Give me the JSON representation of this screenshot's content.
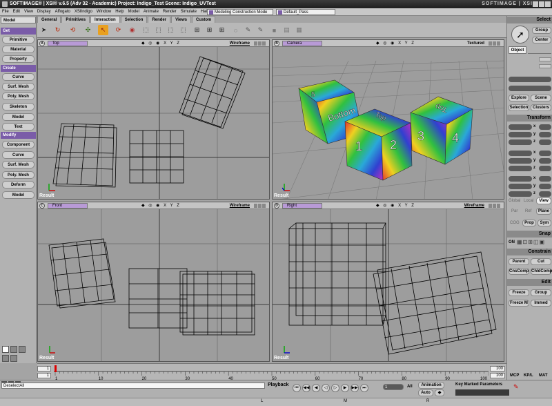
{
  "window": {
    "title": "SOFTIMAGE® | XSI® v.6.5 (Adv 32 - Academic) Project: Indigo_Test    Scene: Indigo_UVTest",
    "brand": "SOFTIMAGE | XSI"
  },
  "menu": [
    "File",
    "Edit",
    "View",
    "Display",
    "Affogato",
    "XSIIndigo",
    "Window",
    "Help",
    "Model",
    "Animate",
    "Render",
    "Simulate",
    "Hair"
  ],
  "mode_dropdown": "Modeling Construction Mode",
  "pass_dropdown": "Default_Pass",
  "toolbar_tabs": [
    "General",
    "Primitives",
    "Interaction",
    "Selection",
    "Render",
    "Views",
    "Custom"
  ],
  "toolbar_icons": [
    "pointer-icon",
    "rotate-icon",
    "rotate-icon",
    "scale-icon",
    "select-icon",
    "refresh-icon",
    "render-icon",
    "rectangle-select-icon",
    "rectangle-select-icon",
    "rectangle-select-icon",
    "rectangle-select-icon",
    "raycast-select-icon",
    "raycast-select-icon",
    "raycast-select-icon",
    "lasso-icon",
    "brush-icon",
    "brush-icon",
    "box-icon",
    "box-icon",
    "box-icon"
  ],
  "left_panel": {
    "model": "Model",
    "sections": [
      {
        "header": "Get",
        "buttons": [
          "Primitive",
          "Material",
          "Property"
        ]
      },
      {
        "header": "Create",
        "buttons": [
          "Curve",
          "Surf. Mesh",
          "Poly. Mesh",
          "Skeleton",
          "Model",
          "Text"
        ]
      },
      {
        "header": "Modify",
        "buttons": [
          "Component",
          "Curve",
          "Surf. Mesh",
          "Poly. Mesh",
          "Deform",
          "Model"
        ]
      }
    ]
  },
  "viewports": [
    {
      "letter": "A",
      "name": "Top",
      "icons": "◆ ◎ ◉ X Y Z",
      "mode": "Wireframe",
      "result": "Result"
    },
    {
      "letter": "B",
      "name": "Camera",
      "icons": "◆ ◎ ◉ X Y Z",
      "mode": "Textured",
      "result": "Result"
    },
    {
      "letter": "C",
      "name": "Front",
      "icons": "◆ ◎ ◉ X Y Z",
      "mode": "Wireframe",
      "result": "Result"
    },
    {
      "letter": "D",
      "name": "Right",
      "icons": "◆ ◎ ◉ X Y Z",
      "mode": "Wireframe",
      "result": "Result"
    }
  ],
  "camera_view": {
    "cube_labels": [
      "Top",
      "Bottom",
      "1",
      "2",
      "3",
      "4",
      "Top",
      "5"
    ]
  },
  "right_panel": {
    "select_header": "Select",
    "select_buttons": [
      "Group",
      "Center",
      "Object",
      "Explore",
      "Scene",
      "Selection",
      "Clusters"
    ],
    "transform_header": "Transform",
    "axes": [
      "x",
      "y",
      "z"
    ],
    "transform_modes": [
      "Global",
      "Local",
      "View",
      "Par",
      "Ref",
      "Plane",
      "COG",
      "Prop",
      "Sym"
    ],
    "snap_header": "Snap",
    "snap_on": "ON",
    "constrain_header": "Constrain",
    "constrain_buttons": [
      "Parent",
      "Cut",
      "CnsComp",
      "ChldComp"
    ],
    "edit_header": "Edit",
    "edit_buttons": [
      "Freeze",
      "Group",
      "Freeze M",
      "Immed"
    ],
    "bottom_tabs": [
      "MCP",
      "KP/L",
      "MAT"
    ]
  },
  "timeline": {
    "start": "1",
    "start_field": "1",
    "end_field": "100",
    "end": "100",
    "ticks": [
      "1",
      "10",
      "20",
      "30",
      "40",
      "50",
      "60",
      "70",
      "80",
      "90",
      "100"
    ]
  },
  "bottom_bar": {
    "selection_field": "DeselectAll",
    "playback_label": "Playback",
    "frame_field": "1",
    "all_label": "All",
    "animation_label": "Animation",
    "auto_label": "Auto",
    "kp_label": "Key Marked Parameters",
    "bottom_letters": [
      "L",
      "M",
      "R"
    ]
  }
}
